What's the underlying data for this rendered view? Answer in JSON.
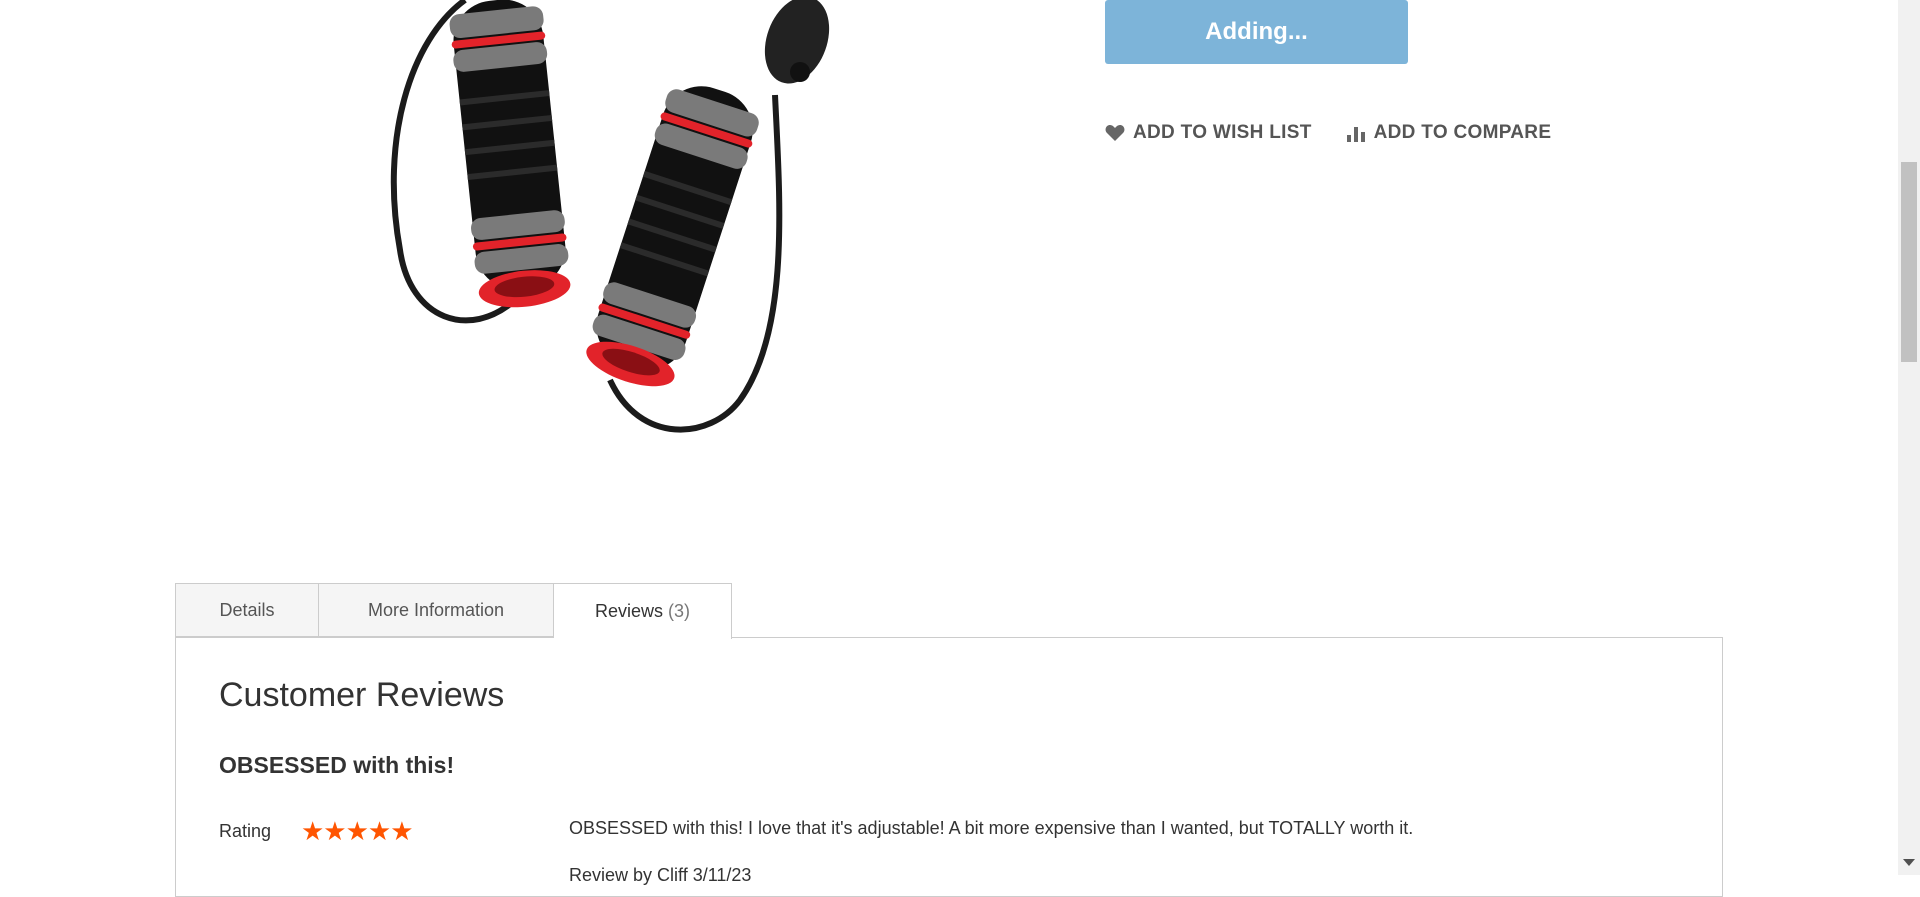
{
  "product": {
    "add_button_label": "Adding...",
    "wishlist_label": "ADD TO WISH LIST",
    "compare_label": "ADD TO COMPARE"
  },
  "tabs": [
    {
      "label": "Details"
    },
    {
      "label": "More Information"
    },
    {
      "label": "Reviews",
      "count": "(3)"
    }
  ],
  "reviews": {
    "heading": "Customer Reviews",
    "items": [
      {
        "title": "OBSESSED with this!",
        "rating_label": "Rating",
        "rating": 5,
        "rating_max": 5,
        "stars": "★★★★★",
        "text": "OBSESSED with this! I love that it's adjustable! A bit more expensive than I wanted, but TOTALLY worth it.",
        "meta": "Review by Cliff 3/11/23"
      }
    ]
  },
  "colors": {
    "button": "#7db4d9",
    "star": "#ff5501",
    "handle_red": "#e2232a",
    "handle_gray": "#7a7a7a"
  }
}
